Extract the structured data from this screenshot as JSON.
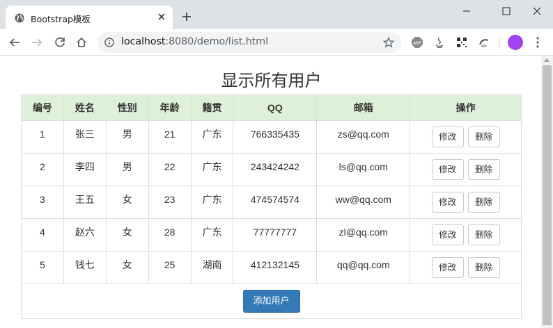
{
  "browser": {
    "tab_title": "Bootstrap模板",
    "url_host": "localhost",
    "url_path": ":8080/demo/list.html"
  },
  "page": {
    "title": "显示所有用户",
    "headers": [
      "编号",
      "姓名",
      "性别",
      "年龄",
      "籍贯",
      "QQ",
      "邮箱",
      "操作"
    ],
    "rows": [
      {
        "id": "1",
        "name": "张三",
        "gender": "男",
        "age": "21",
        "origin": "广东",
        "qq": "766335435",
        "email": "zs@qq.com"
      },
      {
        "id": "2",
        "name": "李四",
        "gender": "男",
        "age": "22",
        "origin": "广东",
        "qq": "243424242",
        "email": "ls@qq.com"
      },
      {
        "id": "3",
        "name": "王五",
        "gender": "女",
        "age": "23",
        "origin": "广东",
        "qq": "474574574",
        "email": "ww@qq.com"
      },
      {
        "id": "4",
        "name": "赵六",
        "gender": "女",
        "age": "28",
        "origin": "广东",
        "qq": "77777777",
        "email": "zl@qq.com"
      },
      {
        "id": "5",
        "name": "钱七",
        "gender": "女",
        "age": "25",
        "origin": "湖南",
        "qq": "412132145",
        "email": "qq@qq.com"
      }
    ],
    "edit_label": "修改",
    "delete_label": "删除",
    "add_label": "添加用户"
  },
  "colors": {
    "header_bg": "#dff0d8",
    "primary": "#337ab7"
  }
}
